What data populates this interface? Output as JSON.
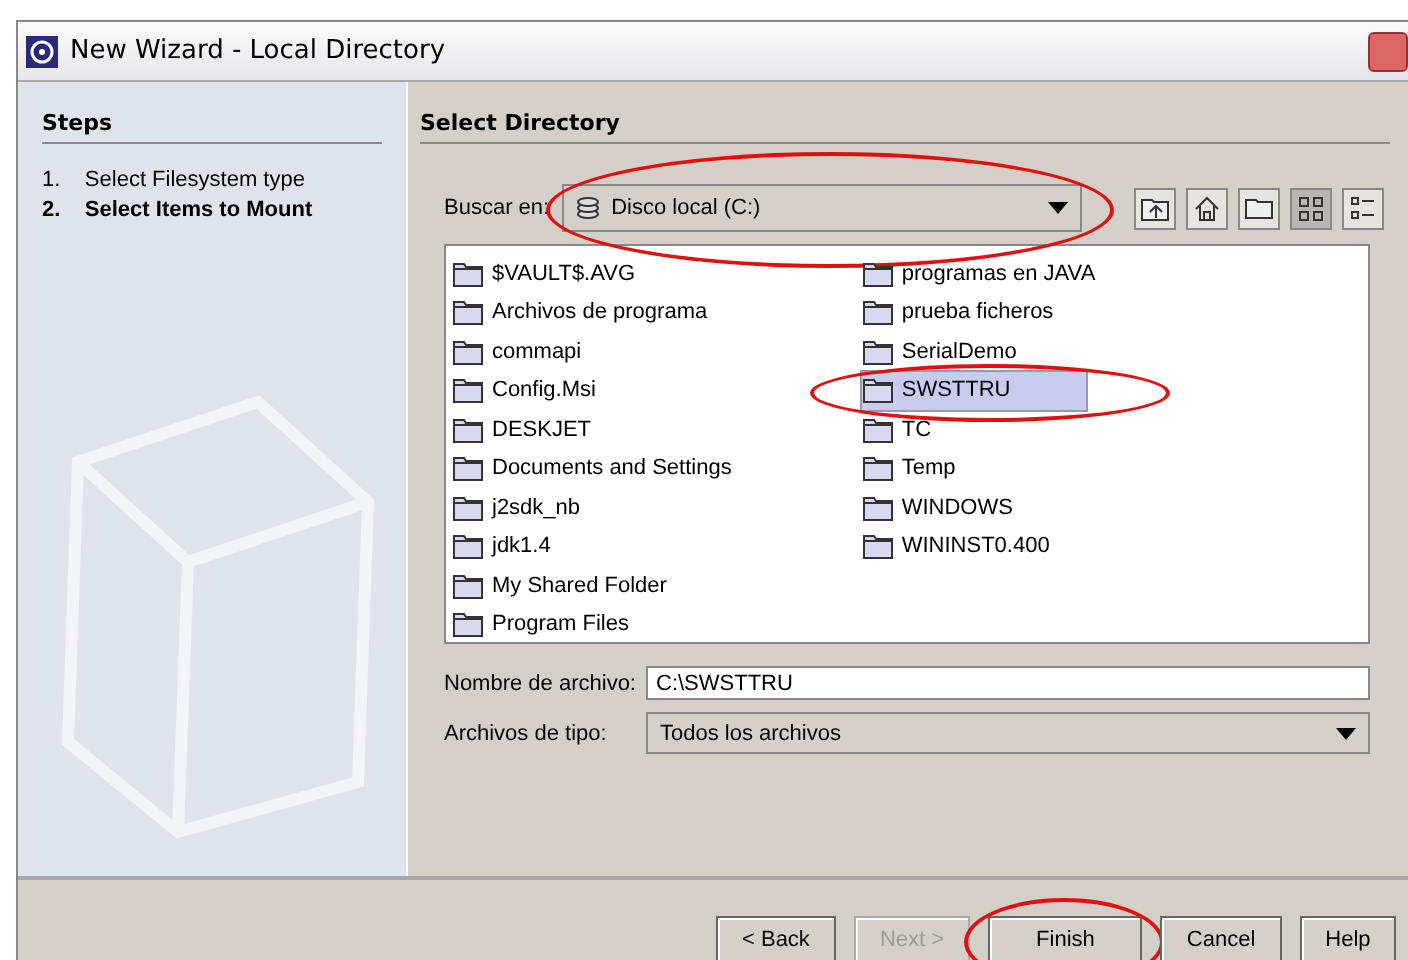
{
  "window": {
    "title": "New Wizard - Local Directory"
  },
  "steps": {
    "title": "Steps",
    "items": [
      {
        "number": "1.",
        "label": "Select Filesystem type",
        "selected": false
      },
      {
        "number": "2.",
        "label": "Select Items to Mount",
        "selected": true
      }
    ]
  },
  "panel": {
    "title": "Select Directory",
    "look_in": {
      "label": "Buscar en:",
      "value": "Disco local (C:)",
      "circled": true
    },
    "files": [
      {
        "name": "$VAULT$.AVG",
        "selected": false,
        "circled": false
      },
      {
        "name": "Archivos de programa",
        "selected": false,
        "circled": false
      },
      {
        "name": "commapi",
        "selected": false,
        "circled": false
      },
      {
        "name": "Config.Msi",
        "selected": false,
        "circled": false
      },
      {
        "name": "DESKJET",
        "selected": false,
        "circled": false
      },
      {
        "name": "Documents and Settings",
        "selected": false,
        "circled": false
      },
      {
        "name": "j2sdk_nb",
        "selected": false,
        "circled": false
      },
      {
        "name": "jdk1.4",
        "selected": false,
        "circled": false
      },
      {
        "name": "My Shared Folder",
        "selected": false,
        "circled": false
      },
      {
        "name": "Program Files",
        "selected": false,
        "circled": false
      },
      {
        "name": "programas en JAVA",
        "selected": false,
        "circled": false
      },
      {
        "name": "prueba ficheros",
        "selected": false,
        "circled": false
      },
      {
        "name": "SerialDemo",
        "selected": false,
        "circled": false
      },
      {
        "name": "SWSTTRU",
        "selected": true,
        "circled": true
      },
      {
        "name": "TC",
        "selected": false,
        "circled": false
      },
      {
        "name": "Temp",
        "selected": false,
        "circled": false
      },
      {
        "name": "WINDOWS",
        "selected": false,
        "circled": false
      },
      {
        "name": "WININST0.400",
        "selected": false,
        "circled": false
      }
    ],
    "file_name": {
      "label": "Nombre de archivo:",
      "value": "C:\\SWSTTRU"
    },
    "file_type": {
      "label": "Archivos de tipo:",
      "value": "Todos los archivos"
    }
  },
  "buttons": [
    {
      "label": "< Back",
      "disabled": false,
      "circled": false
    },
    {
      "label": "Next >",
      "disabled": true,
      "circled": false
    },
    {
      "label": "Finish",
      "disabled": false,
      "circled": true
    },
    {
      "label": "Cancel",
      "disabled": false,
      "circled": false
    },
    {
      "label": "Help",
      "disabled": false,
      "circled": false
    }
  ]
}
